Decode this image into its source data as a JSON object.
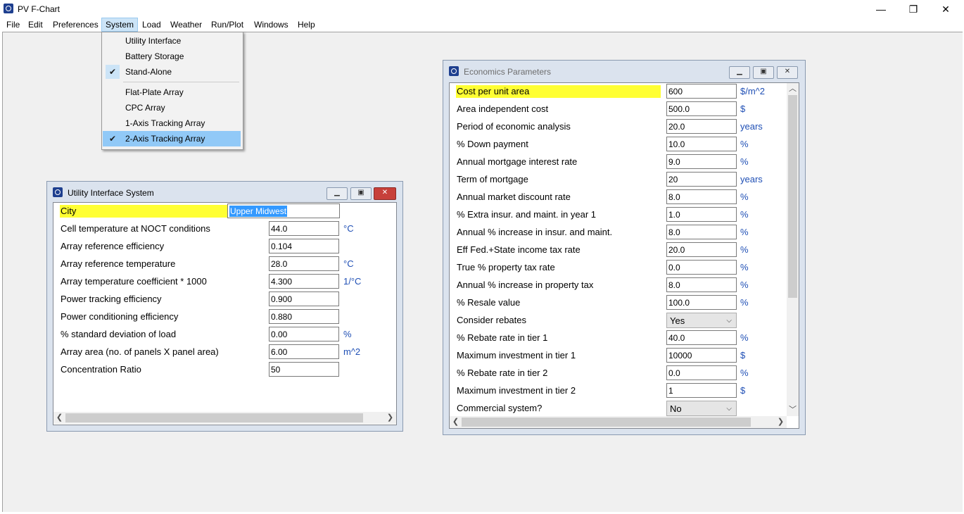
{
  "app": {
    "title": "PV F-Chart",
    "minimize_glyph": "—",
    "restore_glyph": "❐",
    "close_glyph": "✕"
  },
  "menubar": [
    "File",
    "Edit",
    "Preferences",
    "System",
    "Load",
    "Weather",
    "Run/Plot",
    "Windows",
    "Help"
  ],
  "system_menu": {
    "items": [
      {
        "label": "Utility Interface",
        "checked": false
      },
      {
        "label": "Battery Storage",
        "checked": false
      },
      {
        "label": "Stand-Alone",
        "checked": true
      },
      {
        "label": "Flat-Plate Array",
        "checked": false
      },
      {
        "label": "CPC Array",
        "checked": false
      },
      {
        "label": "1-Axis Tracking Array",
        "checked": false
      },
      {
        "label": "2-Axis Tracking Array",
        "checked": true
      }
    ],
    "check_glyph": "✔"
  },
  "utility_window": {
    "title": "Utility Interface System",
    "rows": [
      {
        "label": "City",
        "value": "Upper Midwest",
        "unit": ""
      },
      {
        "label": "Cell temperature at NOCT conditions",
        "value": "44.0",
        "unit": "°C"
      },
      {
        "label": "Array reference efficiency",
        "value": "0.104",
        "unit": ""
      },
      {
        "label": "Array reference temperature",
        "value": "28.0",
        "unit": "°C"
      },
      {
        "label": "Array temperature coefficient * 1000",
        "value": "4.300",
        "unit": "1/°C"
      },
      {
        "label": "Power tracking efficiency",
        "value": "0.900",
        "unit": ""
      },
      {
        "label": "Power conditioning efficiency",
        "value": "0.880",
        "unit": ""
      },
      {
        "label": "% standard deviation of load",
        "value": "0.00",
        "unit": "%"
      },
      {
        "label": "Array area (no. of panels X panel area)",
        "value": "6.00",
        "unit": "m^2"
      },
      {
        "label": "Concentration Ratio",
        "value": "50",
        "unit": ""
      }
    ]
  },
  "economics_window": {
    "title": "Economics Parameters",
    "rows": [
      {
        "label": "Cost per unit area",
        "value": "600",
        "unit": "$/m^2",
        "type": "input"
      },
      {
        "label": "Area independent cost",
        "value": "500.0",
        "unit": "$",
        "type": "input"
      },
      {
        "label": "Period of economic analysis",
        "value": "20.0",
        "unit": "years",
        "type": "input"
      },
      {
        "label": "% Down payment",
        "value": "10.0",
        "unit": "%",
        "type": "input"
      },
      {
        "label": "Annual mortgage interest rate",
        "value": "9.0",
        "unit": "%",
        "type": "input"
      },
      {
        "label": "Term of mortgage",
        "value": "20",
        "unit": "years",
        "type": "input"
      },
      {
        "label": "Annual market discount rate",
        "value": "8.0",
        "unit": "%",
        "type": "input"
      },
      {
        "label": "% Extra insur. and maint. in year 1",
        "value": "1.0",
        "unit": "%",
        "type": "input"
      },
      {
        "label": "Annual % increase in insur. and maint.",
        "value": "8.0",
        "unit": "%",
        "type": "input"
      },
      {
        "label": "Eff Fed.+State income tax rate",
        "value": "20.0",
        "unit": "%",
        "type": "input"
      },
      {
        "label": "True % property tax rate",
        "value": "0.0",
        "unit": "%",
        "type": "input"
      },
      {
        "label": "Annual % increase in property tax",
        "value": "8.0",
        "unit": "%",
        "type": "input"
      },
      {
        "label": "% Resale value",
        "value": "100.0",
        "unit": "%",
        "type": "input"
      },
      {
        "label": "Consider rebates",
        "value": "Yes",
        "unit": "",
        "type": "select"
      },
      {
        "label": "% Rebate rate in tier 1",
        "value": "40.0",
        "unit": "%",
        "type": "input"
      },
      {
        "label": "Maximum investment in tier 1",
        "value": "10000",
        "unit": "$",
        "type": "input"
      },
      {
        "label": "% Rebate rate in tier 2",
        "value": "0.0",
        "unit": "%",
        "type": "input"
      },
      {
        "label": "Maximum investment in tier 2",
        "value": "1",
        "unit": "$",
        "type": "input"
      },
      {
        "label": "Commercial system?",
        "value": "No",
        "unit": "",
        "type": "select"
      }
    ]
  },
  "colors": {
    "highlight": "#ffff33",
    "unit_text": "#1f4fb5",
    "selection": "#3399ff"
  }
}
